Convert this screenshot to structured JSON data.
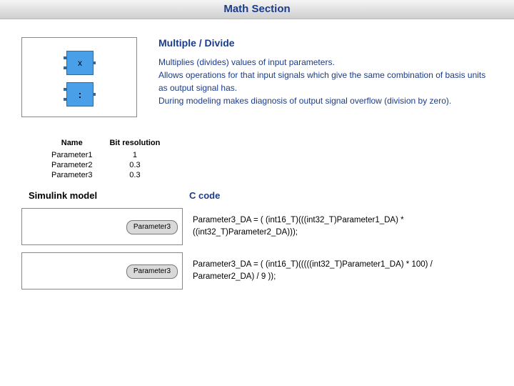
{
  "header": {
    "title": "Math Section"
  },
  "block": {
    "title": "Multiple / Divide",
    "desc1": "Multiplies (divides) values of input parameters.",
    "desc2": "Allows operations for that input signals which give the same combination of basis units as output signal has.",
    "desc3": "During modeling makes diagnosis of output signal overflow (division by zero).",
    "op_mul": "x",
    "op_div": ":"
  },
  "table": {
    "col_name": "Name",
    "col_bit": "Bit resolution",
    "rows": [
      {
        "name": "Parameter1",
        "bit": "1"
      },
      {
        "name": "Parameter2",
        "bit": "0.3"
      },
      {
        "name": "Parameter3",
        "bit": "0.3"
      }
    ]
  },
  "labels": {
    "simulink": "Simulink model",
    "ccode": "C code",
    "out_block": "Parameter3"
  },
  "code": {
    "mul": "Parameter3_DA = ( (int16_T)(((int32_T)Parameter1_DA) * ((int32_T)Parameter2_DA)));",
    "div": "Parameter3_DA = ( (int16_T)(((((int32_T)Parameter1_DA) * 100) / Parameter2_DA) / 9 ));"
  }
}
